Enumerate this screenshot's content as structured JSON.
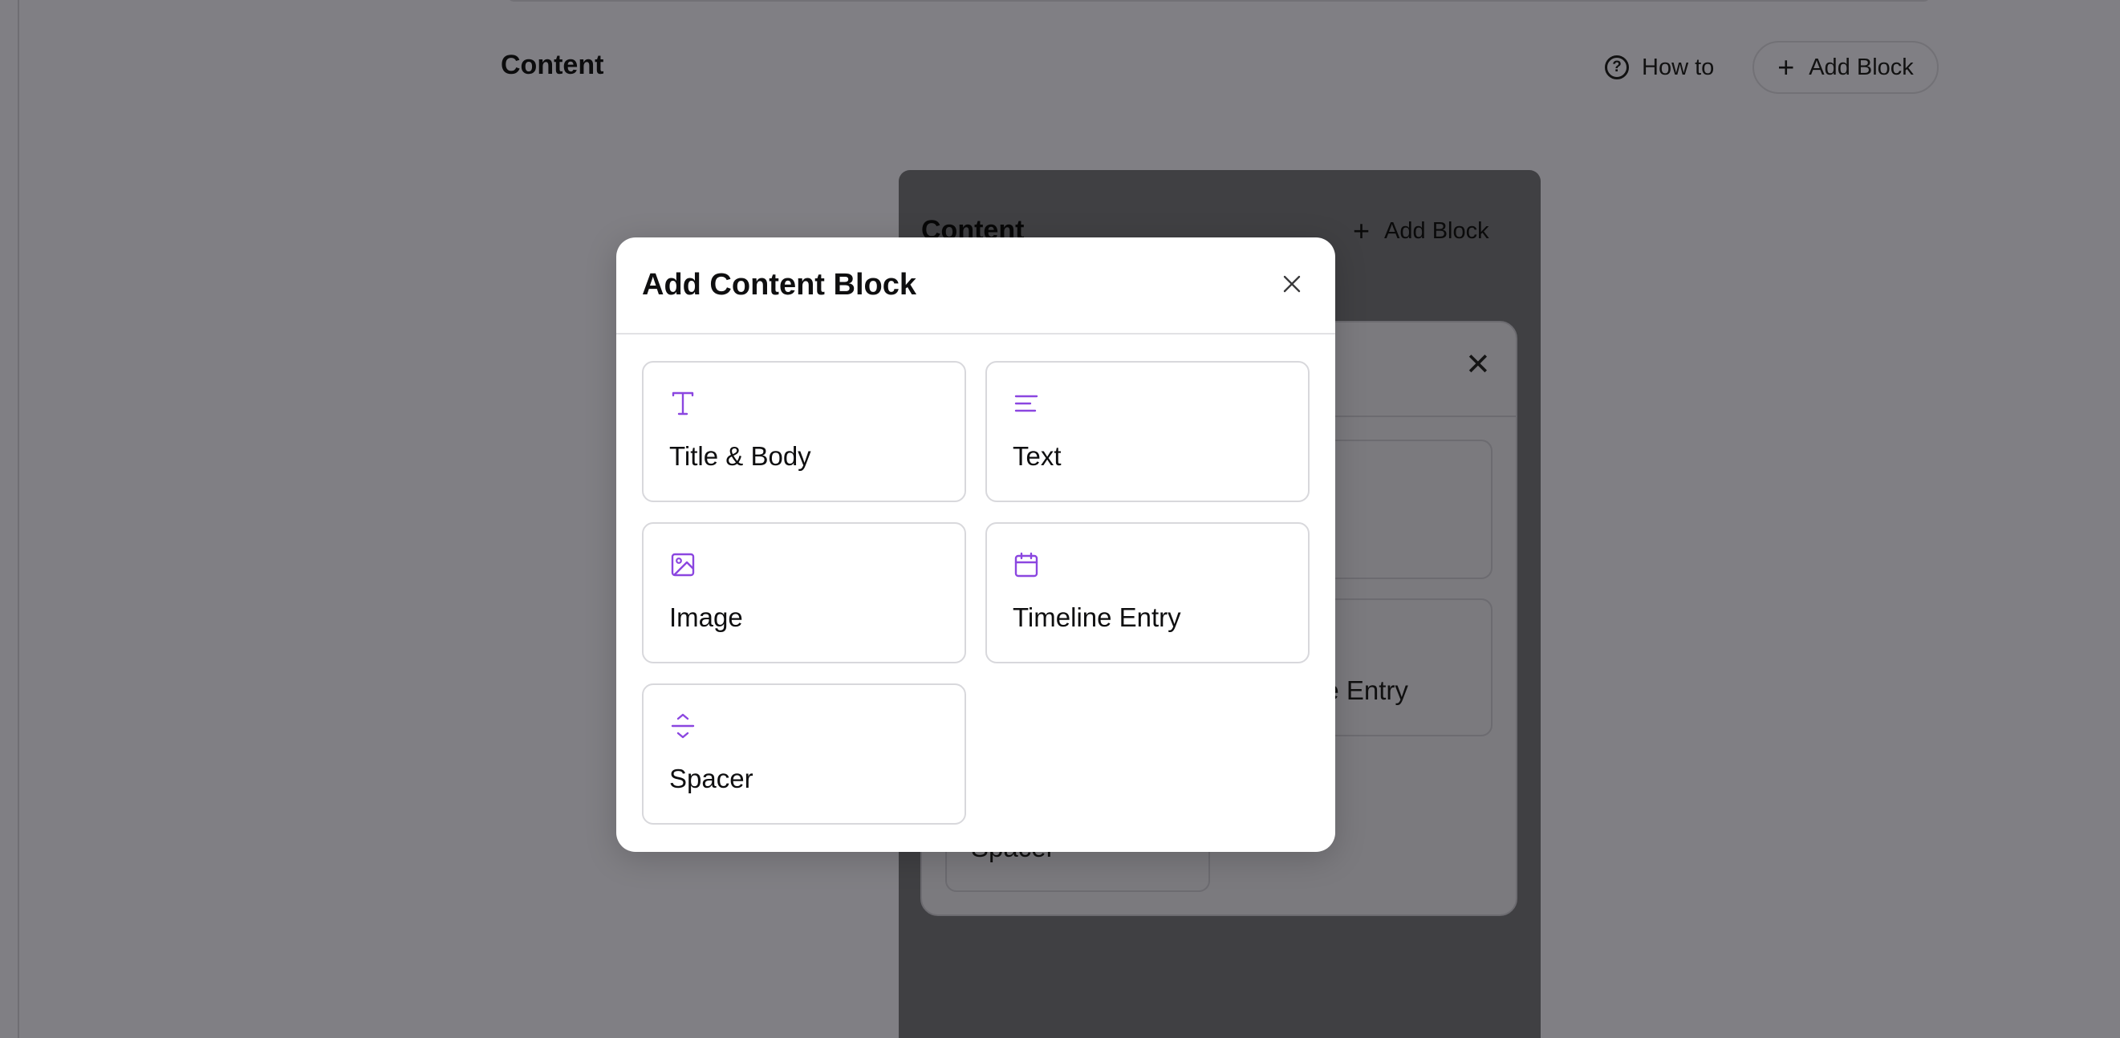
{
  "background": {
    "section_title": "Content",
    "how_to_label": "How to",
    "add_block_label": "Add Block",
    "inner_panel": {
      "title": "Content",
      "add_block_label": "Add Block",
      "visible_labels": {
        "timeline_fragment": "ne Entry",
        "spacer_fragment": "Spacer"
      }
    }
  },
  "modal": {
    "title": "Add Content Block",
    "close_icon": "close-icon",
    "accent_color": "#8b46e0",
    "blocks": [
      {
        "label": "Title & Body",
        "icon": "type-icon"
      },
      {
        "label": "Text",
        "icon": "align-left-icon"
      },
      {
        "label": "Image",
        "icon": "image-icon"
      },
      {
        "label": "Timeline Entry",
        "icon": "calendar-icon"
      },
      {
        "label": "Spacer",
        "icon": "spacer-icon"
      }
    ]
  }
}
